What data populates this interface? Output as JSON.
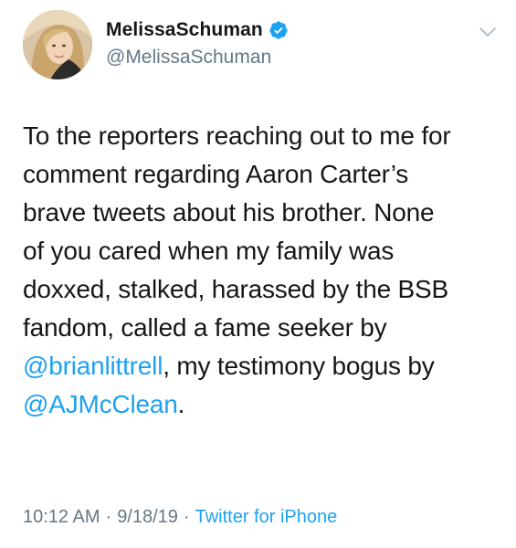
{
  "user": {
    "display_name": "MelissaSchuman",
    "handle": "@MelissaSchuman",
    "verified_icon": "verified-badge-icon",
    "avatar": "profile-photo"
  },
  "tweet": {
    "lines": [
      "To the reporters reaching out to me for",
      "comment regarding Aaron Carter’s",
      "brave tweets about his brother. None",
      "of you cared when my family was",
      "doxxed, stalked, harassed by the BSB",
      "fandom, called a fame seeker by"
    ],
    "line7_mention": "@brianlittrell",
    "line7_rest": ", my testimony bogus by",
    "line8_mention": "@AJMcClean",
    "line8_rest": "."
  },
  "meta": {
    "time": "10:12 AM",
    "date": "9/18/19",
    "separator": "·",
    "source": "Twitter for iPhone"
  },
  "colors": {
    "text": "#14171a",
    "secondary": "#657786",
    "accent": "#1da1f2"
  },
  "icons": {
    "menu": "chevron-down-icon"
  }
}
